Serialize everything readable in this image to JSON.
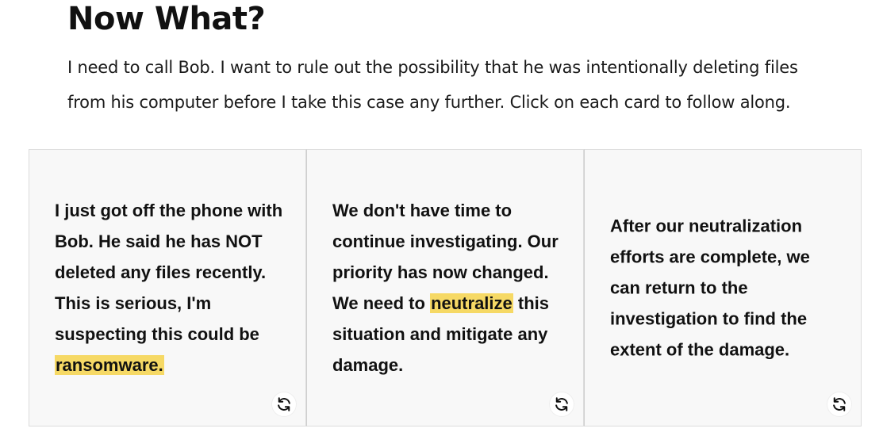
{
  "page": {
    "title": "Now What?",
    "intro": "I need to call Bob. I want to rule out the possibility that he was intentionally deleting files from his computer before I take this case any further. Click on each card to follow along."
  },
  "cards": [
    {
      "text_before": "I just got off the phone with Bob. He said he has NOT deleted any files recently. This is serious, I'm suspecting this could be ",
      "highlight": "ransomware.",
      "text_after": "",
      "flip_icon": "refresh-icon"
    },
    {
      "text_before": "We don't have time to continue investigating. Our priority has now changed. We need to ",
      "highlight": "neutralize",
      "text_after": " this situation and mitigate any damage.",
      "flip_icon": "refresh-icon"
    },
    {
      "text_before": "After our neutralization efforts are complete, we can return to the investigation to find the extent of the damage.",
      "highlight": "",
      "text_after": "",
      "flip_icon": "refresh-icon"
    }
  ],
  "colors": {
    "highlight": "#f6d965",
    "card_background": "#f8f8f8",
    "text": "#111111"
  }
}
